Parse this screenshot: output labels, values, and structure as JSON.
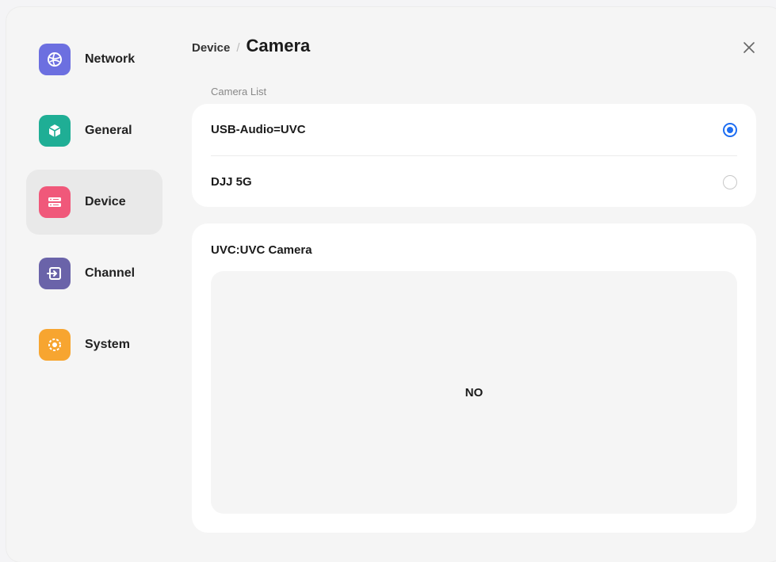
{
  "sidebar": {
    "items": [
      {
        "label": "Network",
        "icon": "globe-icon",
        "color": "#6c6fe0"
      },
      {
        "label": "General",
        "icon": "cube-icon",
        "color": "#1fae95"
      },
      {
        "label": "Device",
        "icon": "device-icon",
        "color": "#f0587a",
        "active": true
      },
      {
        "label": "Channel",
        "icon": "input-icon",
        "color": "#6a63a9"
      },
      {
        "label": "System",
        "icon": "system-icon",
        "color": "#f7a530"
      }
    ]
  },
  "header": {
    "breadcrumb_parent": "Device",
    "breadcrumb_separator": "/",
    "title": "Camera"
  },
  "camera_list": {
    "label": "Camera List",
    "items": [
      {
        "name": "USB-Audio=UVC",
        "selected": true
      },
      {
        "name": "DJJ 5G",
        "selected": false
      }
    ]
  },
  "preview": {
    "title": "UVC:UVC Camera",
    "status": "NO"
  },
  "colors": {
    "accent": "#1e6ef2"
  }
}
